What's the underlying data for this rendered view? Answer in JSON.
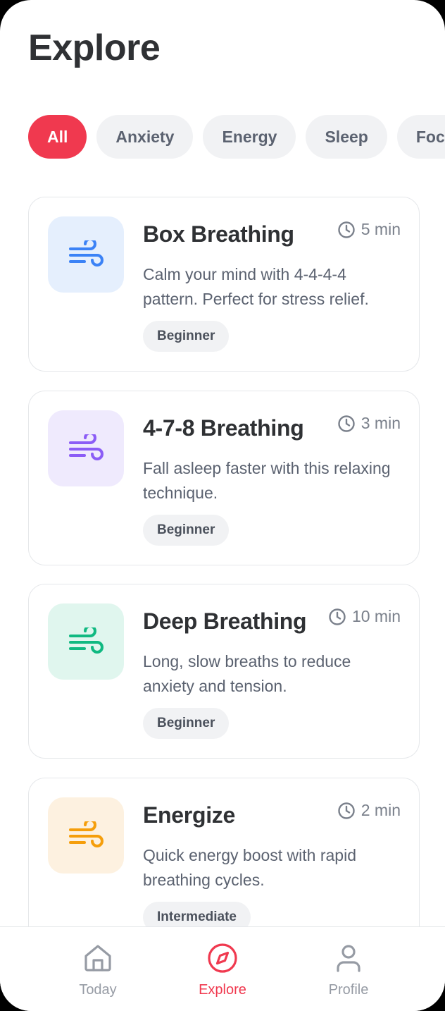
{
  "header": {
    "title": "Explore"
  },
  "filters": [
    {
      "label": "All",
      "active": true
    },
    {
      "label": "Anxiety",
      "active": false
    },
    {
      "label": "Energy",
      "active": false
    },
    {
      "label": "Sleep",
      "active": false
    },
    {
      "label": "Focus",
      "active": false
    }
  ],
  "exercises": [
    {
      "title": "Box Breathing",
      "duration": "5 min",
      "description": "Calm your mind with 4-4-4-4 pattern. Perfect for stress relief.",
      "level": "Beginner",
      "icon": "wind-icon",
      "icon_color": "#3b82f6",
      "icon_bg": "#e5effd"
    },
    {
      "title": "4-7-8 Breathing",
      "duration": "3 min",
      "description": "Fall asleep faster with this relaxing technique.",
      "level": "Beginner",
      "icon": "wind-icon",
      "icon_color": "#8b5cf6",
      "icon_bg": "#efeafd"
    },
    {
      "title": "Deep Breathing",
      "duration": "10 min",
      "description": "Long, slow breaths to reduce anxiety and tension.",
      "level": "Beginner",
      "icon": "wind-icon",
      "icon_color": "#10b981",
      "icon_bg": "#e0f6ee"
    },
    {
      "title": "Energize",
      "duration": "2 min",
      "description": "Quick energy boost with rapid breathing cycles.",
      "level": "Intermediate",
      "icon": "wind-icon",
      "icon_color": "#f59e0b",
      "icon_bg": "#fdf1e0"
    }
  ],
  "tabbar": {
    "today": {
      "label": "Today",
      "icon": "home-icon"
    },
    "explore": {
      "label": "Explore",
      "icon": "compass-icon",
      "active": true
    },
    "profile": {
      "label": "Profile",
      "icon": "user-icon"
    }
  },
  "colors": {
    "accent": "#f0394f",
    "text": "#2f3134",
    "muted": "#5b6270"
  }
}
